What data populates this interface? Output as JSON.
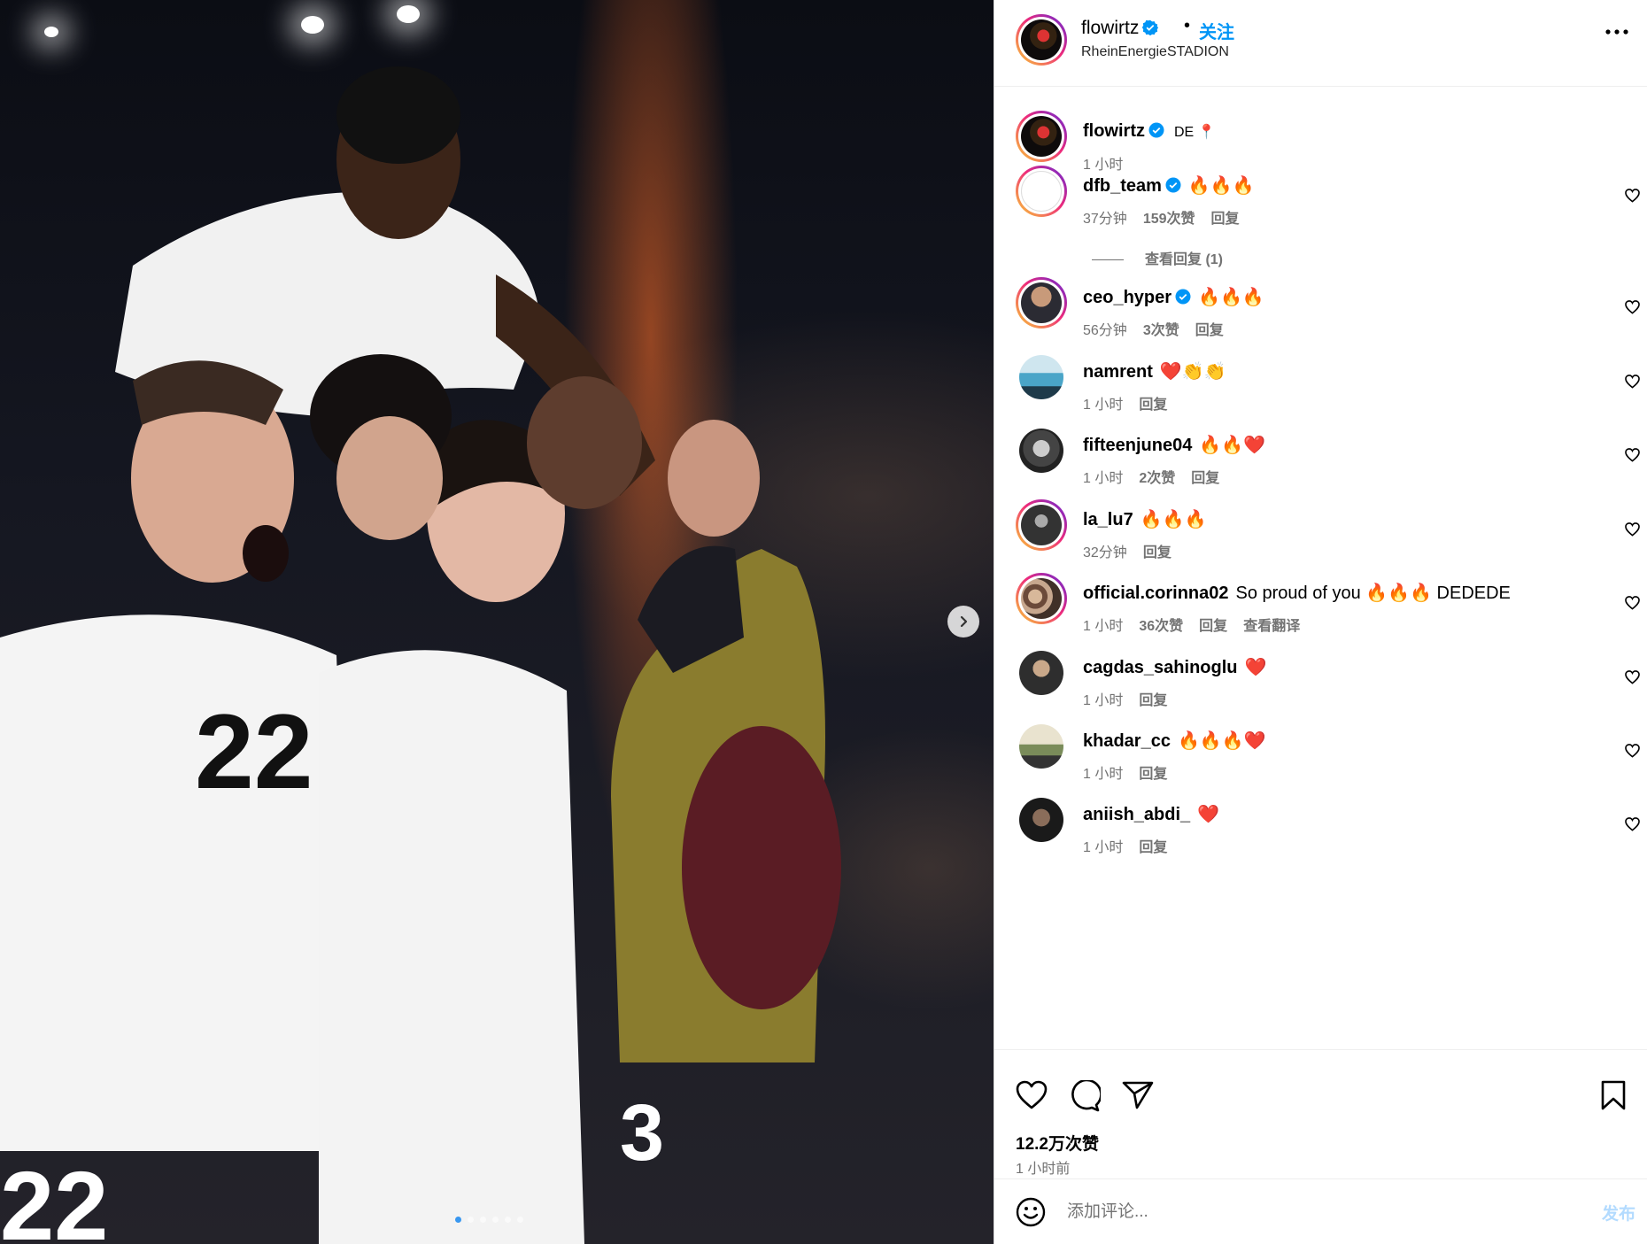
{
  "post_header": {
    "username": "flowirtz",
    "separator": "•",
    "follow_label": "关注",
    "location": "RheinEnergieSTADION"
  },
  "caption": {
    "username": "flowirtz",
    "text": "DE 📍",
    "time": "1 小时"
  },
  "comments": [
    {
      "username": "dfb_team",
      "verified": true,
      "text": "🔥🔥🔥",
      "time": "37分钟",
      "likes": "159次赞",
      "reply": "回复",
      "view_replies": "查看回复 (1)"
    },
    {
      "username": "ceo_hyper",
      "verified": true,
      "text": "🔥🔥🔥",
      "time": "56分钟",
      "likes": "3次赞",
      "reply": "回复"
    },
    {
      "username": "namrent",
      "text": "❤️👏👏",
      "time": "1 小时",
      "reply": "回复"
    },
    {
      "username": "fifteenjune04",
      "text": "🔥🔥❤️",
      "time": "1 小时",
      "likes": "2次赞",
      "reply": "回复"
    },
    {
      "username": "la_lu7",
      "text": "🔥🔥🔥",
      "time": "32分钟",
      "reply": "回复"
    },
    {
      "username": "official.corinna02",
      "text": "So proud of you 🔥🔥🔥 DEDEDE",
      "time": "1 小时",
      "likes": "36次赞",
      "reply": "回复",
      "translate": "查看翻译"
    },
    {
      "username": "cagdas_sahinoglu",
      "text": "❤️",
      "time": "1 小时",
      "reply": "回复"
    },
    {
      "username": "khadar_cc",
      "text": "🔥🔥🔥❤️",
      "time": "1 小时",
      "reply": "回复"
    },
    {
      "username": "aniish_abdi_",
      "text": "❤️",
      "time": "1 小时",
      "reply": "回复"
    }
  ],
  "footer": {
    "likes": "12.2万次赞",
    "time": "1 小时前"
  },
  "add_comment": {
    "placeholder": "添加评论...",
    "post_label": "发布"
  },
  "icons": {
    "like": "heart-icon",
    "comment": "comment-icon",
    "share": "send-icon",
    "save": "bookmark-icon",
    "more": "more-horizontal-icon",
    "emoji": "emoji-icon",
    "verified": "verified-badge-icon"
  },
  "colors": {
    "accent": "#0095f6",
    "verified": "#0095f6",
    "post_button": "#b3dbff",
    "muted": "#737373"
  },
  "carousel": {
    "slide_count": 6,
    "active_slide": 1
  }
}
